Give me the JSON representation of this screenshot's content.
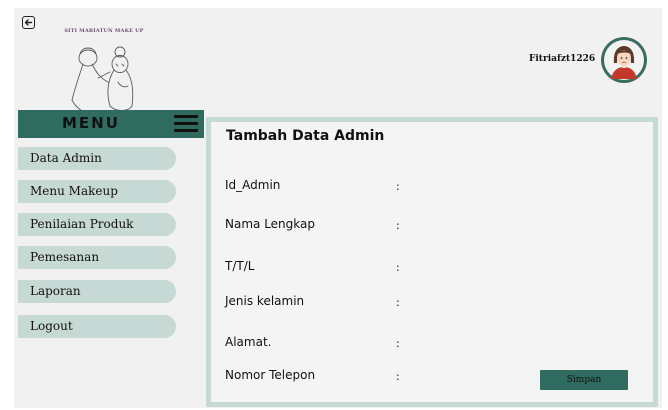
{
  "header": {
    "back_icon": "arrow-left-box-icon",
    "logo_text": "SITI MARIATUN MAKE UP",
    "user_name": "Fitriafzt1226",
    "avatar_icon": "female-user-avatar"
  },
  "sidebar": {
    "menu_title": "MENU",
    "menu_icon": "hamburger-icon",
    "items": [
      {
        "label": "Data Admin"
      },
      {
        "label": "Menu Makeup"
      },
      {
        "label": "Penilaian Produk"
      },
      {
        "label": "Pemesanan"
      },
      {
        "label": "Laporan"
      },
      {
        "label": "Logout"
      }
    ]
  },
  "form": {
    "title": "Tambah Data Admin",
    "fields": [
      {
        "label": "Id_Admin",
        "separator": ":",
        "value": ""
      },
      {
        "label": "Nama Lengkap",
        "separator": ":",
        "value": ""
      },
      {
        "label": "T/T/L",
        "separator": ":",
        "value": ""
      },
      {
        "label": "Jenis kelamin",
        "separator": ":",
        "value": ""
      },
      {
        "label": "Alamat.",
        "separator": ":",
        "value": ""
      },
      {
        "label": "Nomor Telepon",
        "separator": ":",
        "value": ""
      }
    ],
    "submit_label": "Simpan"
  },
  "colors": {
    "accent": "#2f6b5e",
    "menu_item_bg": "#c6d9d4",
    "panel_border": "#c6d9d4",
    "background": "#f1f1f1"
  }
}
